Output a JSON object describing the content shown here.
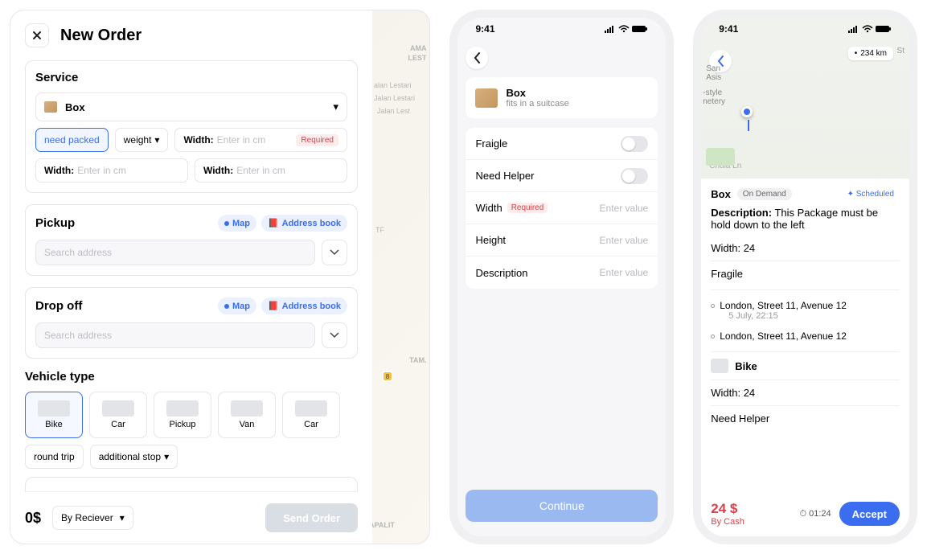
{
  "panel1": {
    "title": "New Order",
    "service": {
      "heading": "Service",
      "selector_label": "Box",
      "chip_need_packed": "need packed",
      "chip_weight": "weight",
      "width_label": "Width:",
      "width_ph": "Enter in cm",
      "required": "Required"
    },
    "pickup": {
      "heading": "Pickup",
      "map": "Map",
      "book": "Address book",
      "search_ph": "Search address"
    },
    "dropoff": {
      "heading": "Drop off",
      "map": "Map",
      "book": "Address book",
      "search_ph": "Search address"
    },
    "vehicle": {
      "heading": "Vehicle type",
      "items": [
        "Bike",
        "Car",
        "Pickup",
        "Van",
        "Car"
      ],
      "round_trip": "round trip",
      "additional_stop": "additional stop"
    },
    "footer": {
      "price": "0$",
      "by": "By Reciever",
      "send": "Send Order"
    },
    "map_labels": {
      "t1": "AMA",
      "t2": "LEST",
      "t3": "alan Lestari",
      "t4": "Jalan Lestari",
      "t5": "Jalan Lest",
      "tam": "TAM.",
      "apalit": "APALIT",
      "tf": "TF"
    }
  },
  "phone2": {
    "time": "9:41",
    "box_title": "Box",
    "box_sub": "fits in a suitcase",
    "rows": {
      "fragile": "Fraigle",
      "helper": "Need Helper",
      "width": "Width",
      "height": "Height",
      "desc": "Description"
    },
    "required": "Required",
    "enter_value": "Enter value",
    "continue": "Continue"
  },
  "phone3": {
    "time": "9:41",
    "box_label": "Box",
    "on_demand": "On Demand",
    "scheduled": "Scheduled",
    "desc_label": "Description:",
    "desc_text": "This Package must be hold down to the left",
    "width": "Width: 24",
    "fragile": "Fragile",
    "addr1": "London, Street 11, Avenue 12",
    "addr1_time": "5 July, 22:15",
    "addr2": "London, Street 11, Avenue 12",
    "vehicle": "Bike",
    "v_width": "Width: 24",
    "need_helper": "Need Helper",
    "price": "24 $",
    "by_cash": "By Cash",
    "timer": "01:24",
    "accept": "Accept",
    "map": {
      "san_asis": "San\nAsis",
      "style": "-style\nnetery",
      "st": "St",
      "chula": "Chula Ln",
      "km": "234 km"
    }
  }
}
